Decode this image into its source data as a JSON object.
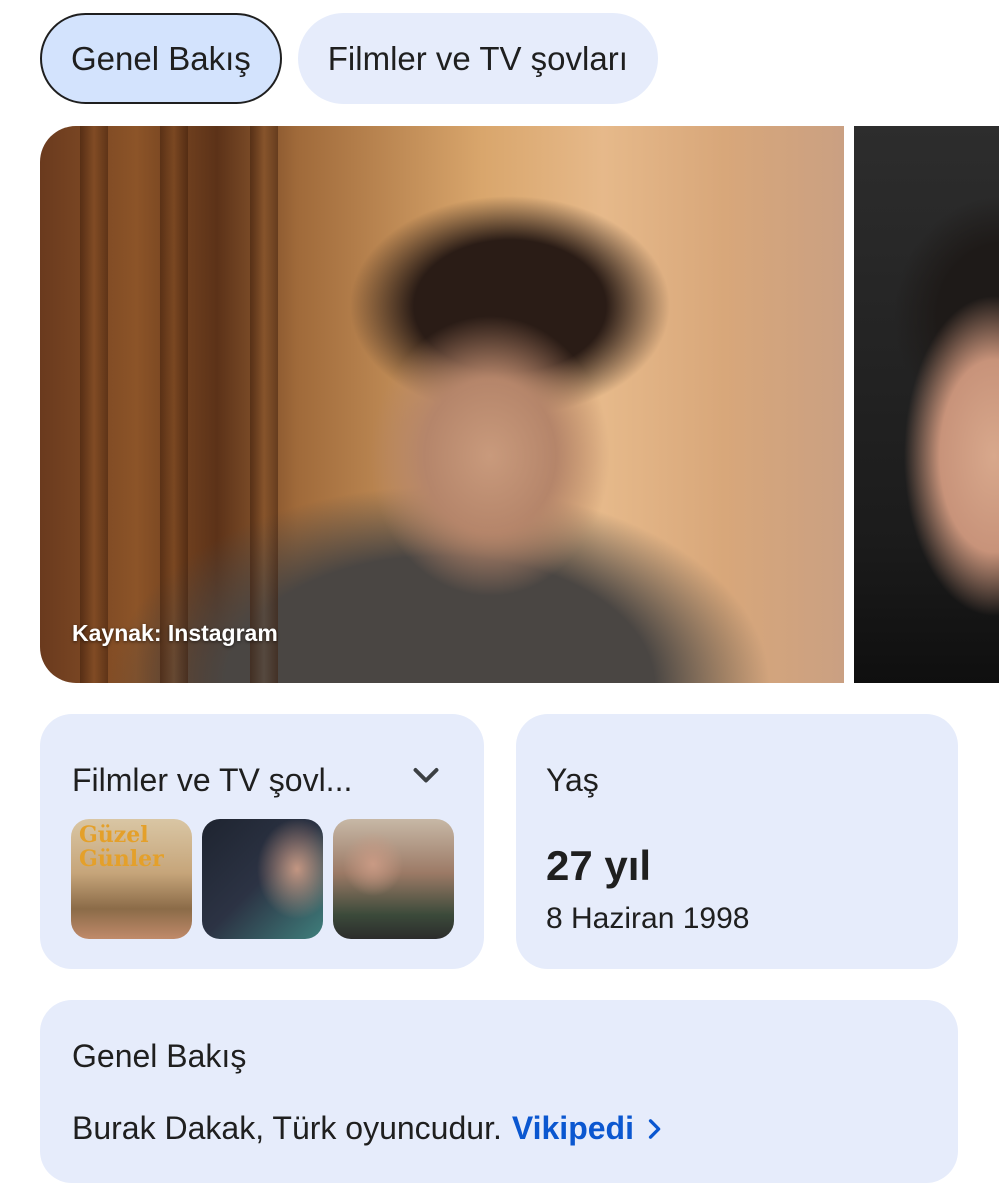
{
  "tabs": [
    {
      "label": "Genel Bakış",
      "active": true
    },
    {
      "label": "Filmler ve TV şovları",
      "active": false
    }
  ],
  "images": {
    "main_caption": "Kaynak: Instagram"
  },
  "films_card": {
    "title": "Filmler ve TV şovl...",
    "expand_icon": "chevron-down-icon",
    "thumbnails": [
      {
        "name": "poster-guzel-gunler",
        "text": "Güzel Günler"
      },
      {
        "name": "poster-2",
        "text": ""
      },
      {
        "name": "poster-3",
        "text": ""
      }
    ]
  },
  "age_card": {
    "label": "Yaş",
    "value": "27 yıl",
    "date": "8 Haziran 1998"
  },
  "overview": {
    "title": "Genel Bakış",
    "text": "Burak Dakak, Türk oyuncudur.",
    "link_label": "Vikipedi",
    "link_icon": "chevron-right-icon"
  },
  "colors": {
    "card_bg": "#e6ecfb",
    "active_chip_bg": "#d3e3fd",
    "link": "#0b57d0"
  }
}
